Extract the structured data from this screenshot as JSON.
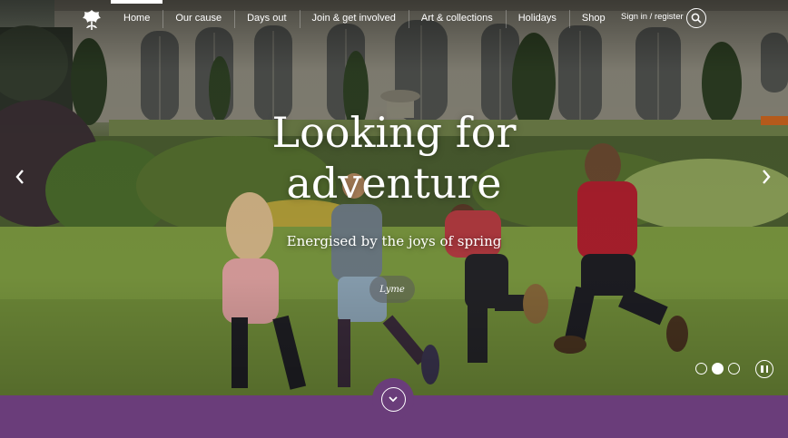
{
  "header": {
    "logo_icon": "oak-leaf-logo-icon",
    "nav": [
      {
        "label": "Home",
        "active": true
      },
      {
        "label": "Our cause",
        "active": false
      },
      {
        "label": "Days out",
        "active": false
      },
      {
        "label": "Join & get involved",
        "active": false
      },
      {
        "label": "Art & collections",
        "active": false
      },
      {
        "label": "Holidays",
        "active": false
      },
      {
        "label": "Shop",
        "active": false
      }
    ],
    "signin_label": "Sign in / register",
    "search_icon": "search-icon"
  },
  "hero": {
    "headline_line1": "Looking for",
    "headline_line2": "adventure",
    "subheadline": "Energised by the joys of spring",
    "location": "Lyme",
    "prev_icon": "chevron-left-icon",
    "next_icon": "chevron-right-icon",
    "slides": [
      {
        "active": false
      },
      {
        "active": true
      },
      {
        "active": false
      }
    ],
    "pause_icon": "pause-icon"
  },
  "footer_band": {
    "scroll_icon": "chevron-down-icon"
  },
  "colors": {
    "band": "#6a3d7a",
    "text": "#ffffff"
  }
}
